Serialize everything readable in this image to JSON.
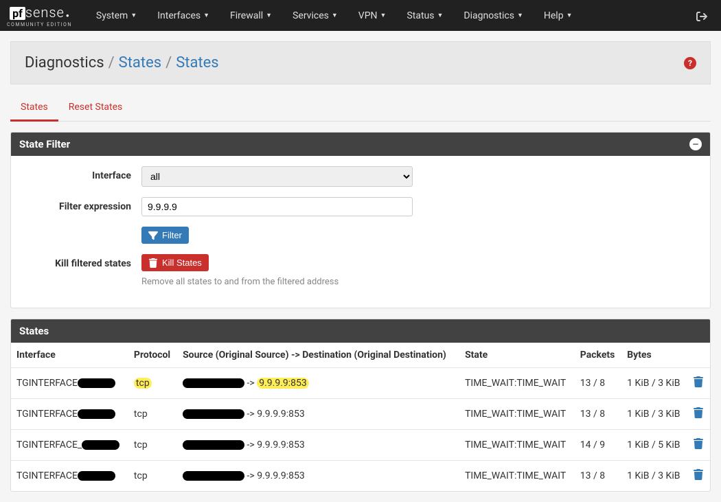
{
  "nav": {
    "items": [
      "System",
      "Interfaces",
      "Firewall",
      "Services",
      "VPN",
      "Status",
      "Diagnostics",
      "Help"
    ]
  },
  "logo": {
    "pf": "pf",
    "sense": "sense",
    "sub": "COMMUNITY EDITION"
  },
  "breadcrumb": {
    "current": "Diagnostics",
    "link1": "States",
    "link2": "States"
  },
  "tabs": {
    "active": "States",
    "other": "Reset States"
  },
  "filter_panel": {
    "title": "State Filter",
    "interface_label": "Interface",
    "interface_value": "all",
    "filter_label": "Filter expression",
    "filter_value": "9.9.9.9",
    "filter_btn": "Filter",
    "kill_label": "Kill filtered states",
    "kill_btn": "Kill States",
    "kill_help": "Remove all states to and from the filtered address"
  },
  "states_panel": {
    "title": "States",
    "headers": {
      "interface": "Interface",
      "protocol": "Protocol",
      "srcdst": "Source (Original Source) -> Destination (Original Destination)",
      "state": "State",
      "packets": "Packets",
      "bytes": "Bytes"
    },
    "rows": [
      {
        "interface": "TGINTERFACE",
        "protocol": "tcp",
        "dest": "9.9.9.9:853",
        "state": "TIME_WAIT:TIME_WAIT",
        "packets": "13 / 8",
        "bytes": "1 KiB / 3 KiB",
        "highlight": true
      },
      {
        "interface": "TGINTERFACE",
        "protocol": "tcp",
        "dest": "9.9.9.9:853",
        "state": "TIME_WAIT:TIME_WAIT",
        "packets": "13 / 8",
        "bytes": "1 KiB / 3 KiB",
        "highlight": false
      },
      {
        "interface": "TGINTERFACE_",
        "protocol": "tcp",
        "dest": "9.9.9.9:853",
        "state": "TIME_WAIT:TIME_WAIT",
        "packets": "14 / 9",
        "bytes": "1 KiB / 5 KiB",
        "highlight": false
      },
      {
        "interface": "TGINTERFACE",
        "protocol": "tcp",
        "dest": "9.9.9.9:853",
        "state": "TIME_WAIT:TIME_WAIT",
        "packets": "13 / 8",
        "bytes": "1 KiB / 3 KiB",
        "highlight": false
      }
    ]
  }
}
